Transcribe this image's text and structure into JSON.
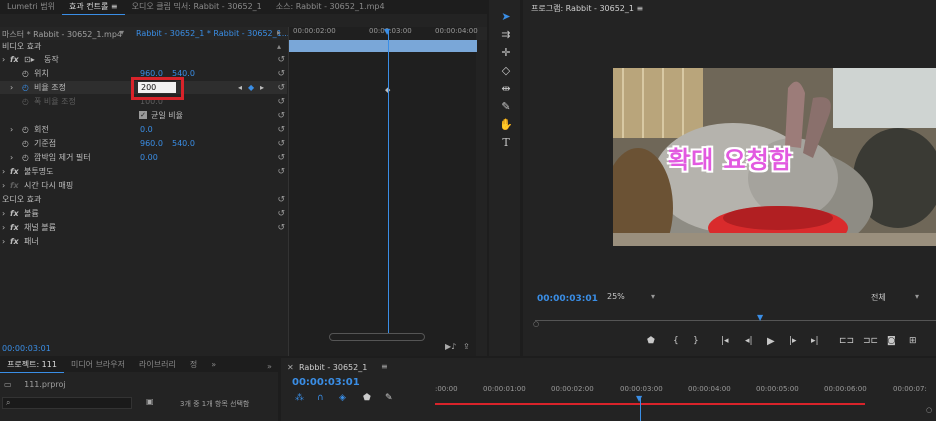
{
  "effect_panel": {
    "tabs": [
      "Lumetri 범위",
      "효과 컨트롤",
      "오디오 클립 믹서: Rabbit - 30652_1",
      "소스: Rabbit - 30652_1.mp4"
    ],
    "menu_icon": "≡",
    "source_clip": "마스터 * Rabbit - 30652_1.mp4",
    "sequence_clip": "Rabbit - 30652_1 * Rabbit - 30652_1...",
    "ruler": [
      "00:00:02:00",
      "00:00:03:00",
      "00:00:04:00"
    ],
    "sections": {
      "video": "비디오 효과",
      "audio": "오디오 효과"
    },
    "motion": "동작",
    "properties": {
      "position": {
        "label": "위치",
        "x": "960.0",
        "y": "540.0"
      },
      "scale": {
        "label": "비율 조정",
        "value": "200"
      },
      "scale_width": {
        "label": "폭 비율 조정",
        "value": "100.0"
      },
      "uniform": "균일 비율",
      "rotation": {
        "label": "회전",
        "value": "0.0"
      },
      "anchor": {
        "label": "기준점",
        "x": "960.0",
        "y": "540.0"
      },
      "flicker": {
        "label": "깜박임 제거 필터",
        "value": "0.00"
      }
    },
    "opacity": "불투명도",
    "time_remap": "시간 다시 매핑",
    "volume": "볼륨",
    "channel_volume": "채널 볼륨",
    "panner": "패너",
    "timecode": "00:00:03:01"
  },
  "program": {
    "title": "프로그램: Rabbit - 30652_1",
    "menu_icon": "≡",
    "overlay_text": "확대 요청함",
    "timecode": "00:00:03:01",
    "zoom": "25%",
    "quality": "전체"
  },
  "project_panel": {
    "tabs": [
      "프로젝트: 111",
      "미디어 브라우저",
      "라이브러리",
      "정"
    ],
    "file": "111.prproj",
    "search_placeholder": "",
    "selection_status": "3개 중 1개 항목 선택함",
    "more_icon": "»"
  },
  "timeline": {
    "tab": "Rabbit - 30652_1",
    "timecode": "00:00:03:01",
    "ruler": [
      ":00:00",
      "00:00:01:00",
      "00:00:02:00",
      "00:00:03:00",
      "00:00:04:00",
      "00:00:05:00",
      "00:00:06:00",
      "00:00:07:"
    ]
  },
  "colors": {
    "accent": "#3a8ee6",
    "highlight_box": "#d8232a",
    "overlay_text": "#e25ae0",
    "work_area": "#d8232a"
  }
}
